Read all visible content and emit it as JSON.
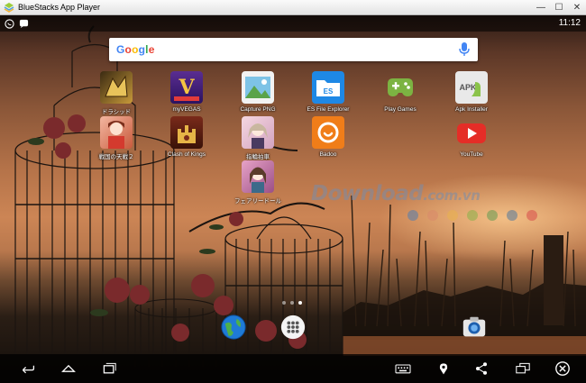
{
  "window": {
    "title": "BlueStacks App Player",
    "minimize_label": "—",
    "maximize_label": "☐",
    "close_label": "✕"
  },
  "status": {
    "time": "11:12"
  },
  "search": {
    "brand": "Google",
    "value": "",
    "placeholder": ""
  },
  "apps": [
    {
      "id": "app-dragon",
      "label": "ドラシッド",
      "icon": "dragon-game-icon"
    },
    {
      "id": "app-myvegas",
      "label": "myVEGAS",
      "icon": "slots-icon"
    },
    {
      "id": "app-capture-png",
      "label": "Capture PNG",
      "icon": "image-icon"
    },
    {
      "id": "app-es-file-explorer",
      "label": "ES File Explorer",
      "icon": "folder-icon"
    },
    {
      "id": "app-play-games",
      "label": "Play Games",
      "icon": "gamepad-icon"
    },
    {
      "id": "app-apk-installer",
      "label": "Apk Installer",
      "icon": "apk-icon"
    },
    {
      "id": "app-sengoku",
      "label": "戦国の天戦２",
      "icon": "anime-game-icon"
    },
    {
      "id": "app-clash-of-kings",
      "label": "Clash of Kings",
      "icon": "castle-game-icon"
    },
    {
      "id": "app-yubiwa",
      "label": "指輪拍車",
      "icon": "anime-game-icon"
    },
    {
      "id": "app-badoo",
      "label": "Badoo",
      "icon": "badoo-icon"
    },
    {
      "id": "app-youtube",
      "label": "YouTube",
      "icon": "youtube-icon"
    },
    {
      "id": "app-fairy-doll",
      "label": "フェアリードール",
      "icon": "anime-game-icon"
    }
  ],
  "watermark": {
    "text": "Download",
    "suffix": ".com.vn"
  },
  "watermark_colors": [
    "#5b7fa8",
    "#d98a6a",
    "#e7b14f",
    "#8fb04c",
    "#6e9d55",
    "#5f7d99",
    "#d9534f"
  ],
  "colors": {
    "google_blue": "#4285f4",
    "google_red": "#ea4335",
    "google_yellow": "#fbbc05",
    "google_green": "#34a853",
    "youtube_red": "#e52d27",
    "badoo_orange": "#f07d19",
    "es_blue": "#1e88e5",
    "play_green": "#7cb342"
  },
  "dock": [
    "browser-globe-icon",
    "app-drawer-icon",
    "camera-icon"
  ],
  "navbar": [
    "back-icon",
    "home-icon",
    "recents-icon",
    "keyboard-icon",
    "location-icon",
    "share-icon",
    "screen-mirror-icon",
    "close-circle-icon"
  ]
}
